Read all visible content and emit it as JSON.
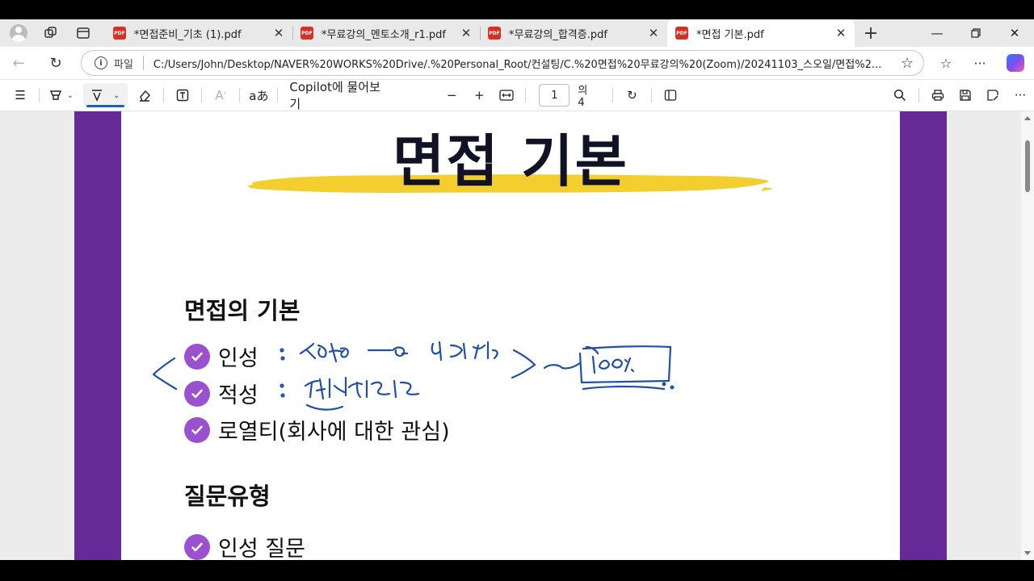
{
  "tabs": [
    {
      "title": "*면접준비_기초 (1).pdf",
      "icon": "pdf-icon",
      "active": false
    },
    {
      "title": "*무료강의_멘토소개_r1.pdf",
      "icon": "pdf-icon",
      "active": false
    },
    {
      "title": "*무료강의_합격증.pdf",
      "icon": "pdf-icon",
      "active": false
    },
    {
      "title": "*면접 기본.pdf",
      "icon": "pdf-icon",
      "active": true
    }
  ],
  "pdf_icon_text": "PDF",
  "address": {
    "scheme_label": "파일",
    "url": "C:/Users/John/Desktop/NAVER%20WORKS%20Drive/.%20Personal_Root/컨설팅/C.%20면접%20무료강의%20(Zoom)/20241103_스오일/면접%2..."
  },
  "pdf_toolbar": {
    "read_aloud_label": "aあ",
    "copilot_label": "Copilot에 물어보기",
    "page_current": "1",
    "page_total": "의 4"
  },
  "slide": {
    "title": "면접 기본",
    "section1_heading": "면접의 기본",
    "bullets1": [
      "인성",
      "적성",
      "로열티(회사에  대한 관심)"
    ],
    "section2_heading": "질문유형",
    "bullets2": [
      "인성 질문"
    ]
  },
  "colors": {
    "page_band": "#662a96",
    "check_purple": "#9b50cf",
    "title_brush": "#f2cf2e",
    "ink_blue": "#1f4fa8",
    "accent": "#1a62b8"
  }
}
